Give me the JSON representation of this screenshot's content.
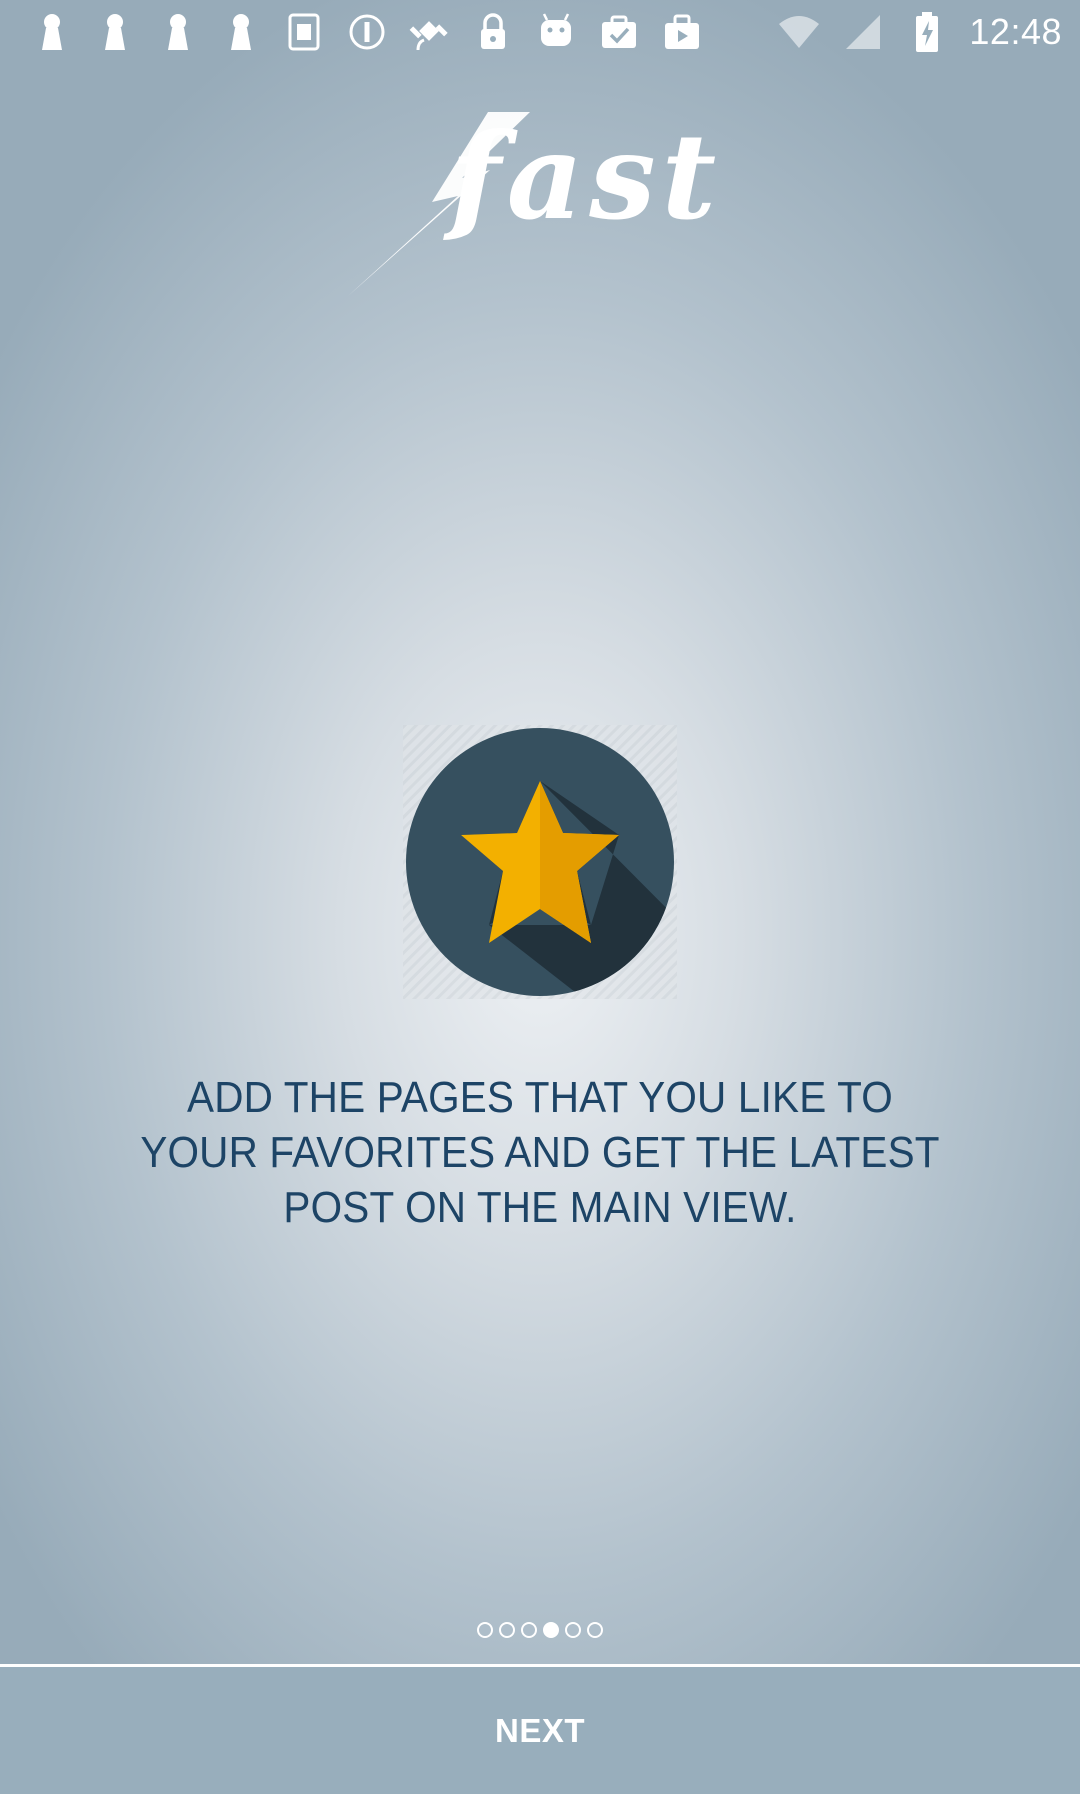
{
  "status_bar": {
    "time": "12:48",
    "icons": [
      "keyhole-icon",
      "keyhole-icon",
      "keyhole-icon",
      "keyhole-icon",
      "sim-tool-icon",
      "info-circle-icon",
      "satellite-icon",
      "lock-icon",
      "android-icon",
      "clipboard-check-icon",
      "briefcase-play-icon",
      "wifi-icon",
      "signal-icon",
      "battery-charging-icon"
    ]
  },
  "logo": {
    "text": "fast"
  },
  "intro": {
    "message": "ADD THE PAGES THAT YOU LIKE TO YOUR FAVORITES AND GET THE LATEST POST ON THE MAIN VIEW.",
    "icon": "star-icon"
  },
  "pager": {
    "total": 6,
    "current": 4
  },
  "footer": {
    "next_label": "NEXT"
  },
  "colors": {
    "message_text": "#1d4466",
    "star_circle": "#36505f",
    "star": "#f3b000",
    "bottom_bar": "#98aebc"
  }
}
